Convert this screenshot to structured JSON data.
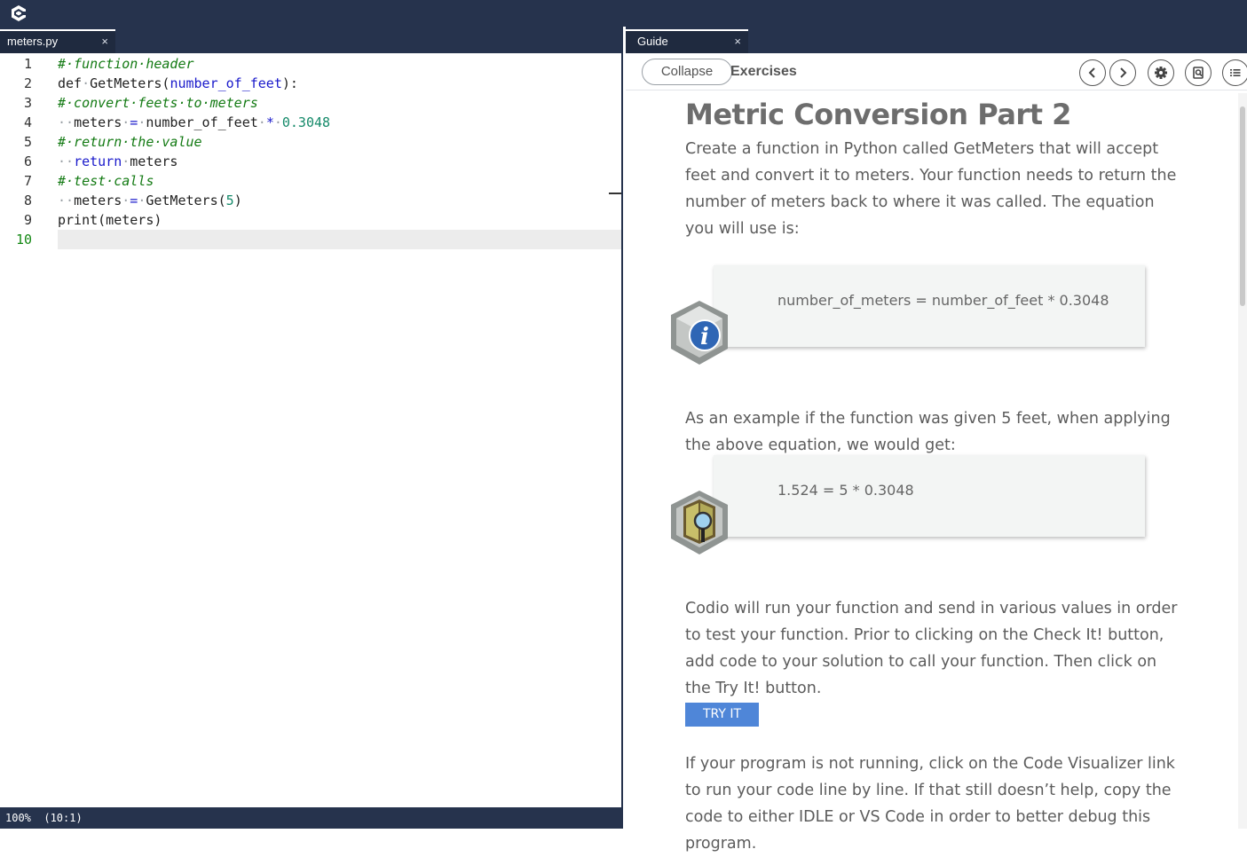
{
  "editor": {
    "tab_title": "meters.py",
    "close_glyph": "×",
    "status": "100%  (10:1)",
    "lines": [
      {
        "n": "1",
        "tokens": [
          {
            "t": "#·function·header",
            "c": "comment"
          }
        ]
      },
      {
        "n": "2",
        "tokens": [
          {
            "t": "def",
            "c": ""
          },
          {
            "t": "·",
            "c": "ws"
          },
          {
            "t": "GetMeters(",
            "c": ""
          },
          {
            "t": "number_of_feet",
            "c": "kw"
          },
          {
            "t": "):",
            "c": ""
          }
        ]
      },
      {
        "n": "3",
        "tokens": [
          {
            "t": "#·convert·feets·to·meters",
            "c": "comment"
          }
        ]
      },
      {
        "n": "4",
        "tokens": [
          {
            "t": "··",
            "c": "ws"
          },
          {
            "t": "meters",
            "c": ""
          },
          {
            "t": "·",
            "c": "ws"
          },
          {
            "t": "=",
            "c": "kw"
          },
          {
            "t": "·",
            "c": "ws"
          },
          {
            "t": "number_of_feet",
            "c": ""
          },
          {
            "t": "·",
            "c": "ws"
          },
          {
            "t": "*",
            "c": "kw"
          },
          {
            "t": "·",
            "c": "ws"
          },
          {
            "t": "0.3048",
            "c": "num"
          }
        ]
      },
      {
        "n": "5",
        "tokens": [
          {
            "t": "#·return·the·value",
            "c": "comment"
          }
        ]
      },
      {
        "n": "6",
        "tokens": [
          {
            "t": "··",
            "c": "ws"
          },
          {
            "t": "return",
            "c": "kw"
          },
          {
            "t": "·",
            "c": "ws"
          },
          {
            "t": "meters",
            "c": ""
          }
        ]
      },
      {
        "n": "7",
        "tokens": [
          {
            "t": "#·test·calls",
            "c": "comment"
          }
        ]
      },
      {
        "n": "8",
        "tokens": [
          {
            "t": "··",
            "c": "ws"
          },
          {
            "t": "meters",
            "c": ""
          },
          {
            "t": "·",
            "c": "ws"
          },
          {
            "t": "=",
            "c": "kw"
          },
          {
            "t": "·",
            "c": "ws"
          },
          {
            "t": "GetMeters(",
            "c": ""
          },
          {
            "t": "5",
            "c": "num"
          },
          {
            "t": ")",
            "c": ""
          }
        ]
      },
      {
        "n": "9",
        "tokens": [
          {
            "t": "print(meters)",
            "c": ""
          }
        ]
      },
      {
        "n": "10",
        "tokens": []
      }
    ]
  },
  "guide": {
    "tab_title": "Guide",
    "close_glyph": "×",
    "collapse_label": "Collapse",
    "section_label": "Exercises",
    "toolbar_icons": [
      "chevron-left-icon",
      "chevron-right-icon",
      "gear-icon",
      "search-document-icon",
      "list-icon"
    ],
    "title": "Metric Conversion Part 2",
    "intro": "Create a function in Python called GetMeters that will accept feet and convert it to meters. Your function needs to return the number of meters back to where it was called. The equation you will use is:",
    "equation_1": "number_of_meters = number_of_feet * 0.3048",
    "example_text": "As an example if the function was given 5 feet, when applying the above equation, we would get:",
    "equation_2": "1.524 = 5 * 0.3048",
    "instructions": "Codio will run your function and send in various values in order to test your function. Prior to clicking on the Check It! button, add code to your solution to call your function. Then click on the Try It! button.",
    "try_label": "TRY IT",
    "debug_text": "If your program is not running, click on the Code Visualizer link to run your code line by line. If that still doesn’t help, copy the code to either IDLE or VS Code in order to better debug this program."
  },
  "colors": {
    "chrome": "#26334d",
    "accent_button": "#4f86d8",
    "comment": "#137a13",
    "keyword": "#1a1acb",
    "number": "#158a6a"
  }
}
